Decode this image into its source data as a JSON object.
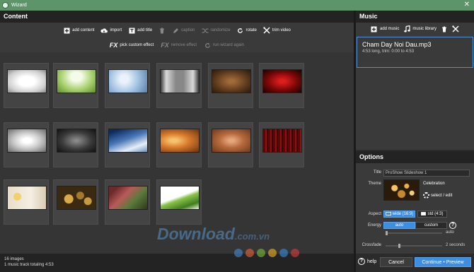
{
  "window": {
    "title": "Wizard",
    "close": "✕"
  },
  "content": {
    "header": "Content",
    "toolbar": {
      "add_content": "add content",
      "import": "import",
      "add_title": "add title",
      "caption": "caption",
      "randomize": "randomize",
      "rotate": "rotate",
      "trim_video": "trim video"
    },
    "toolbar2": {
      "fx": "FX",
      "pick_custom_effect": "pick custom effect",
      "remove_effect": "remove effect",
      "run_wizard_again": "run wizard again"
    }
  },
  "status": {
    "images": "16 images",
    "music": "1 music track totaling 4:53"
  },
  "music": {
    "header": "Music",
    "add_music": "add music",
    "music_library": "music library",
    "track": {
      "name": "Cham Day Noi Dau.mp3",
      "info": "4:53 long, trim: 0:00 to 4:53"
    }
  },
  "options": {
    "header": "Options",
    "title_label": "Title",
    "title_value": "ProShow Slideshow 1",
    "theme_label": "Theme",
    "theme_name": "Celebration",
    "theme_select": "select / edit",
    "aspect_label": "Aspect",
    "aspect_wide": "wide (16:9)",
    "aspect_std": "std (4:3)",
    "energy_label": "Energy",
    "energy_auto": "auto",
    "energy_custom": "custom",
    "energy_slider_label": "auto",
    "crossfade_label": "Crossfade",
    "crossfade_value": "2 seconds"
  },
  "footer": {
    "help": "help",
    "cancel": "Cancel",
    "continue": "Continue • Preview"
  },
  "watermark": {
    "main": "Download",
    "domain": ".com.vn"
  },
  "colors": {
    "accent": "#3d8ee0",
    "titlebar": "#5e9469",
    "selection_border": "#4a8fd8"
  }
}
